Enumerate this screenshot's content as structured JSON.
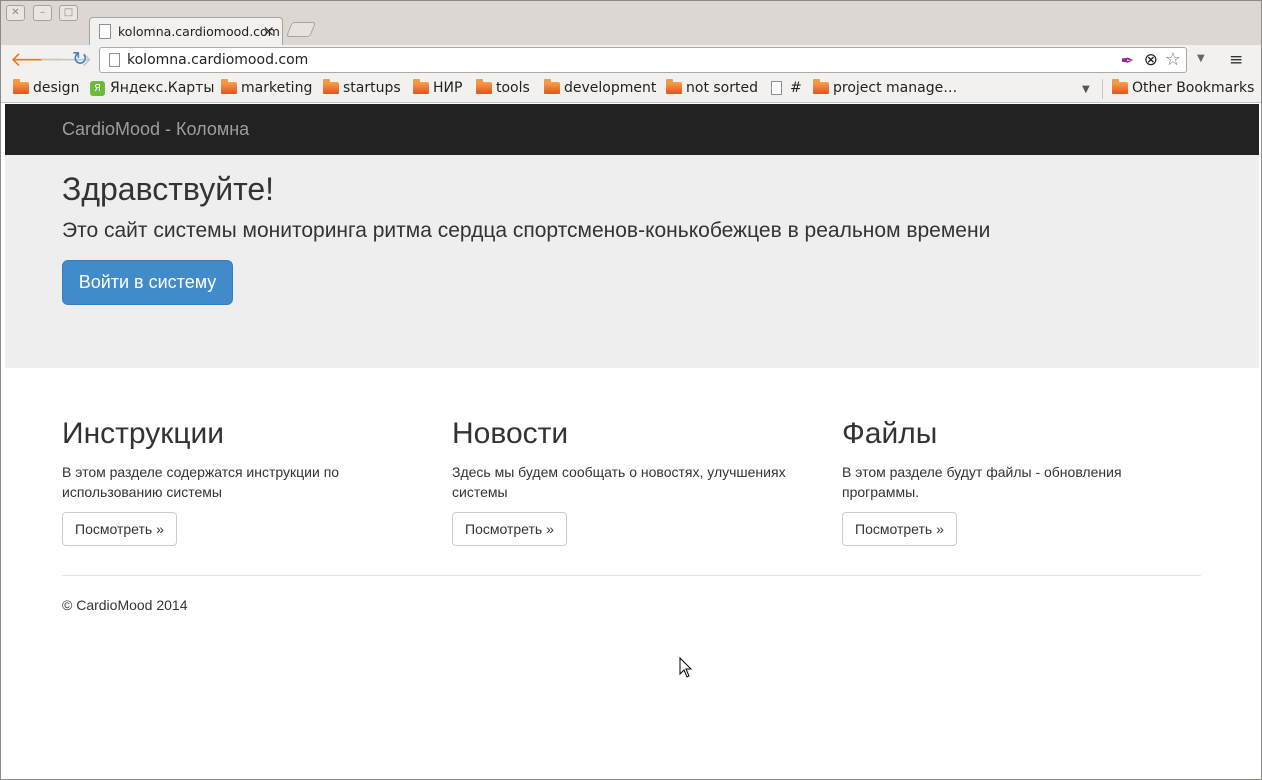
{
  "browser": {
    "tab": {
      "title": "kolomna.cardiomood.com",
      "close": "×"
    },
    "window_controls": {
      "close": "✕",
      "minimize": "–",
      "maximize": "□"
    },
    "nav": {
      "back": "🡐",
      "forward": "🡒",
      "reload": "↻"
    },
    "address_bar": {
      "url": "kolomna.cardiomood.com"
    },
    "menu_icon": "≡",
    "bookmarks": [
      {
        "label": "design",
        "icon": "folder"
      },
      {
        "label": "Яндекс.Карты",
        "icon": "yandex-maps"
      },
      {
        "label": "marketing",
        "icon": "folder"
      },
      {
        "label": "startups",
        "icon": "folder"
      },
      {
        "label": "НИР",
        "icon": "folder"
      },
      {
        "label": "tools",
        "icon": "folder"
      },
      {
        "label": "development",
        "icon": "folder"
      },
      {
        "label": "not sorted",
        "icon": "folder"
      },
      {
        "label": "#",
        "icon": "page"
      },
      {
        "label": "project manage…",
        "icon": "folder"
      }
    ],
    "other_bookmarks": "Other Bookmarks"
  },
  "site": {
    "brand": "CardioMood - Коломна",
    "jumbotron": {
      "title": "Здравствуйте!",
      "lead": "Это сайт системы мониторинга ритма сердца спортсменов-конькобежцев в реальном времени",
      "button": "Войти в систему"
    },
    "columns": [
      {
        "title": "Инструкции",
        "text": "В этом разделе содержатся инструкции по использованию системы",
        "button": "Посмотреть »"
      },
      {
        "title": "Новости",
        "text": "Здесь мы будем сообщать о новостях, улучшениях системы",
        "button": "Посмотреть »"
      },
      {
        "title": "Файлы",
        "text": "В этом разделе будут файлы - обновления программы.",
        "button": "Посмотреть »"
      }
    ],
    "footer": "© CardioMood 2014"
  }
}
